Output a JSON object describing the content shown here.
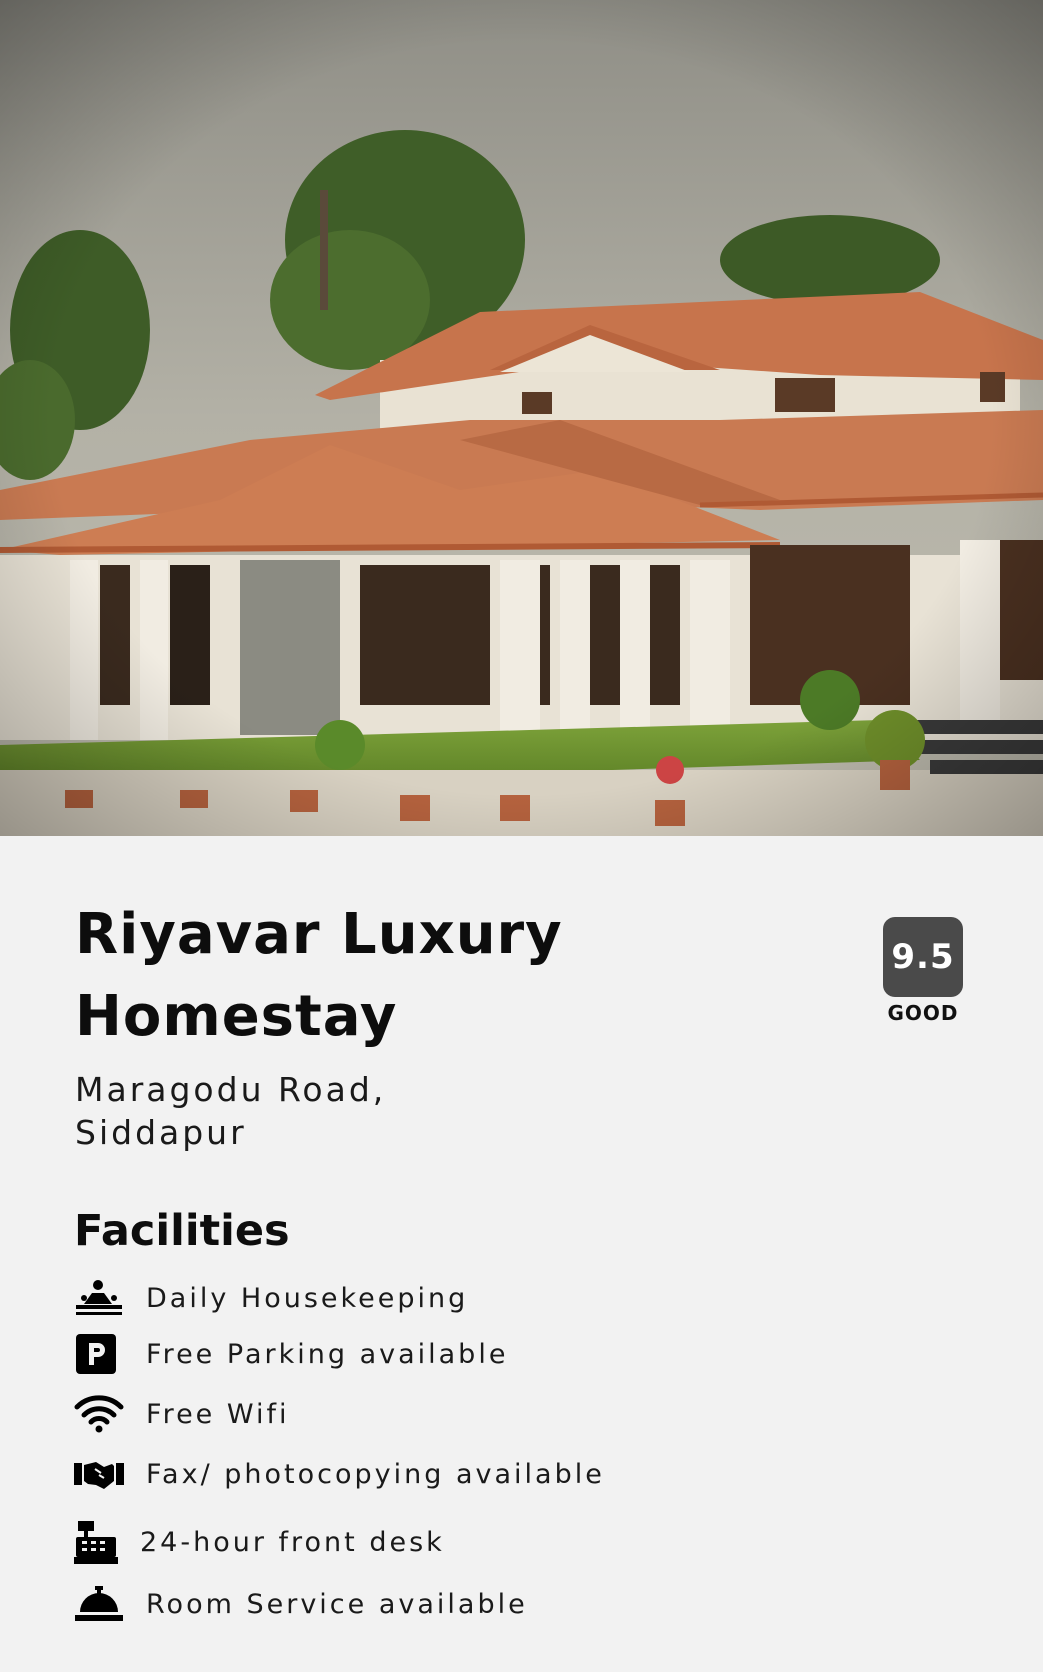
{
  "hero": {
    "image": "homestay-photo"
  },
  "property": {
    "name": "Riyavar Luxury Homestay",
    "address": "Maragodu Road, Siddapur"
  },
  "rating": {
    "score": "9.5",
    "label": "GOOD",
    "badge_color": "#4a4a4a"
  },
  "facilities": {
    "heading": "Facilities",
    "items": [
      {
        "icon": "housekeeping-icon",
        "label": "Daily Housekeeping"
      },
      {
        "icon": "parking-icon",
        "label": "Free Parking available"
      },
      {
        "icon": "wifi-icon",
        "label": "Free Wifi"
      },
      {
        "icon": "handshake-icon",
        "label": "Fax/ photocopying available"
      },
      {
        "icon": "cash-register-icon",
        "label": "24-hour front desk"
      },
      {
        "icon": "concierge-bell-icon",
        "label": "Room Service available"
      }
    ]
  }
}
